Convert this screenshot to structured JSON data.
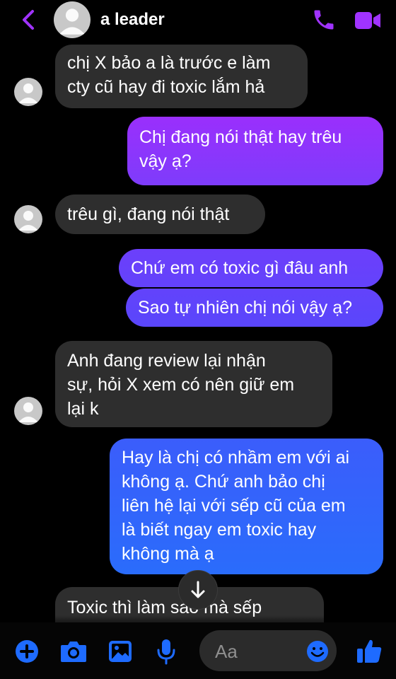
{
  "header": {
    "contact_name": "a leader",
    "icons": [
      "back-arrow-icon",
      "avatar",
      "phone-call-icon",
      "video-call-icon"
    ]
  },
  "messages": [
    {
      "from": "them",
      "text": "chị X bảo a là trước e làm cty cũ hay đi toxic lắm hả",
      "lines": [
        "chị X bảo a là trước e làm",
        "cty cũ hay đi toxic lắm hả"
      ]
    },
    {
      "from": "me",
      "text": "Chị đang nói thật hay trêu vậy ạ?",
      "lines": [
        "Chị đang nói thật hay trêu",
        "vậy ạ?"
      ]
    },
    {
      "from": "them",
      "text": "trêu gì, đang nói thật",
      "lines": [
        "trêu gì, đang nói thật"
      ]
    },
    {
      "from": "me",
      "text": "Chứ em có toxic gì đâu anh",
      "lines": [
        "Chứ em có toxic gì đâu anh"
      ]
    },
    {
      "from": "me",
      "text": "Sao tự nhiên chị nói vậy ạ?",
      "lines": [
        "Sao tự nhiên chị nói vậy ạ?"
      ]
    },
    {
      "from": "them",
      "text": "Anh đang review lại nhận sự, hỏi X xem có nên giữ em lại k",
      "lines": [
        "Anh đang review lại nhận",
        "sự, hỏi X xem có nên giữ em",
        "lại k"
      ]
    },
    {
      "from": "me",
      "text": "Hay là chị có nhầm em với ai không ạ. Chứ anh bảo chị liên hệ lại với sếp cũ của em là biết ngay em toxic hay không mà ạ",
      "lines": [
        "Hay là chị có nhầm em với ai",
        "không ạ. Chứ anh bảo chị",
        "liên hệ lại với sếp cũ của em",
        "là biết ngay em toxic hay",
        "không mà ạ"
      ]
    },
    {
      "from": "them",
      "text": "Toxic thì làm sao mà sếp",
      "lines": [
        "Toxic thì làm sao mà sếp"
      ]
    }
  ],
  "composer": {
    "placeholder": "Aa",
    "icons": [
      "plus-icon",
      "camera-icon",
      "image-icon",
      "microphone-icon",
      "emoji-icon",
      "thumbs-up-icon"
    ]
  },
  "colors": {
    "accent": "#a033ff",
    "incoming_bubble": "#2e2e2e",
    "outgoing_purple": "#8b33fb",
    "outgoing_blue": "#2d64fb",
    "composer_icon": "#1e6bff"
  }
}
